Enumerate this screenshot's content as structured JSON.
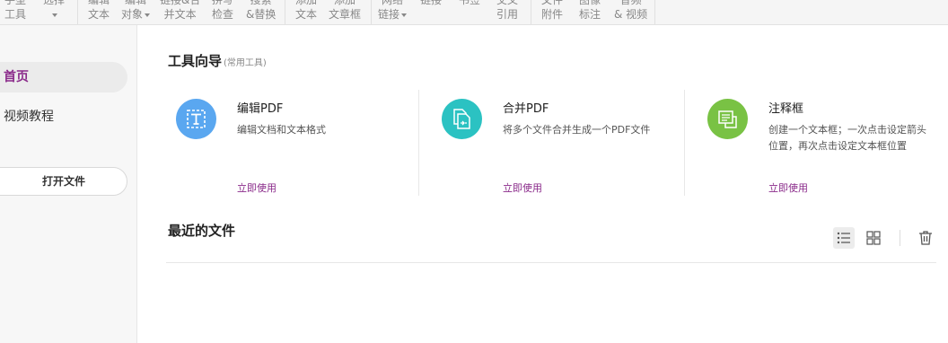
{
  "ribbon": {
    "items": [
      {
        "l1": "手型",
        "l2": "工具",
        "caret": false
      },
      {
        "l1": "选择",
        "l2": "",
        "caret": true
      },
      {
        "l1": "编辑",
        "l2": "文本",
        "caret": false
      },
      {
        "l1": "编辑",
        "l2": "对象",
        "caret": true
      },
      {
        "l1": "链接&合",
        "l2": "并文本",
        "caret": false
      },
      {
        "l1": "拼写",
        "l2": "检查",
        "caret": false
      },
      {
        "l1": "搜索",
        "l2": "&替换",
        "caret": false
      },
      {
        "l1": "添加",
        "l2": "文本",
        "caret": false
      },
      {
        "l1": "添加",
        "l2": "文章框",
        "caret": false
      },
      {
        "l1": "网络",
        "l2": "链接",
        "caret": true
      },
      {
        "l1": "链接",
        "l2": "",
        "caret": false
      },
      {
        "l1": "书签",
        "l2": "",
        "caret": false
      },
      {
        "l1": "交叉",
        "l2": "引用",
        "caret": false
      },
      {
        "l1": "文件",
        "l2": "附件",
        "caret": false
      },
      {
        "l1": "图像",
        "l2": "标注",
        "caret": false
      },
      {
        "l1": "音频",
        "l2": "& 视频",
        "caret": false
      }
    ]
  },
  "sidebar": {
    "items": [
      {
        "label": "首页",
        "active": true
      },
      {
        "label": "视频教程",
        "active": false
      }
    ],
    "open_button": "打开文件"
  },
  "tools": {
    "title": "工具向导",
    "subtitle": "(常用工具)",
    "cards": [
      {
        "title": "编辑PDF",
        "desc": "编辑文档和文本格式",
        "link": "立即使用",
        "color": "#5aa7f0",
        "icon": "edit-text-icon"
      },
      {
        "title": "合并PDF",
        "desc": "将多个文件合并生成一个PDF文件",
        "link": "立即使用",
        "color": "#2bc2c2",
        "icon": "merge-files-icon"
      },
      {
        "title": "注释框",
        "desc": "创建一个文本框；一次点击设定箭头位置，再次点击设定文本框位置",
        "link": "立即使用",
        "color": "#79c244",
        "icon": "callout-icon"
      }
    ]
  },
  "recent": {
    "title": "最近的文件",
    "view_mode": "list"
  },
  "colors": {
    "accent": "#8a2a8a",
    "edit": "#5aa7f0",
    "merge": "#2bc2c2",
    "callout": "#79c244"
  }
}
